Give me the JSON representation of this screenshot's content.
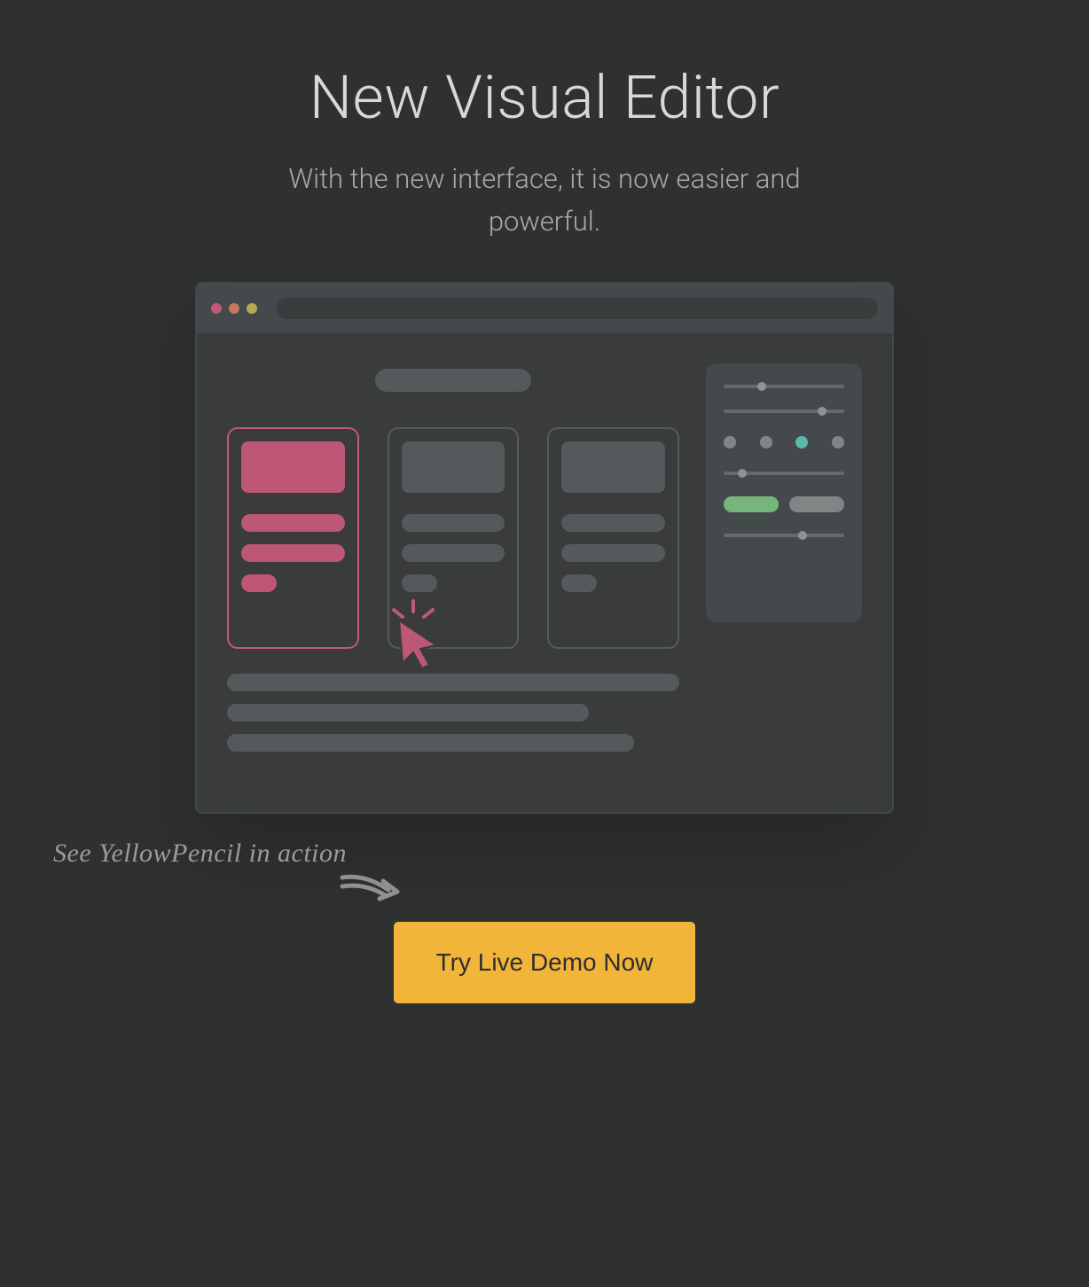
{
  "hero": {
    "title": "New Visual Editor",
    "subtitle": "With the new interface, it is now easier and powerful."
  },
  "callout": {
    "note": "See YellowPencil in action",
    "button_label": "Try Live Demo Now"
  },
  "colors": {
    "accent": "#f1b53a",
    "highlight": "#c05a7a",
    "panel_primary": "#76b67a",
    "panel_swatch_active": "#5cb8a8"
  }
}
